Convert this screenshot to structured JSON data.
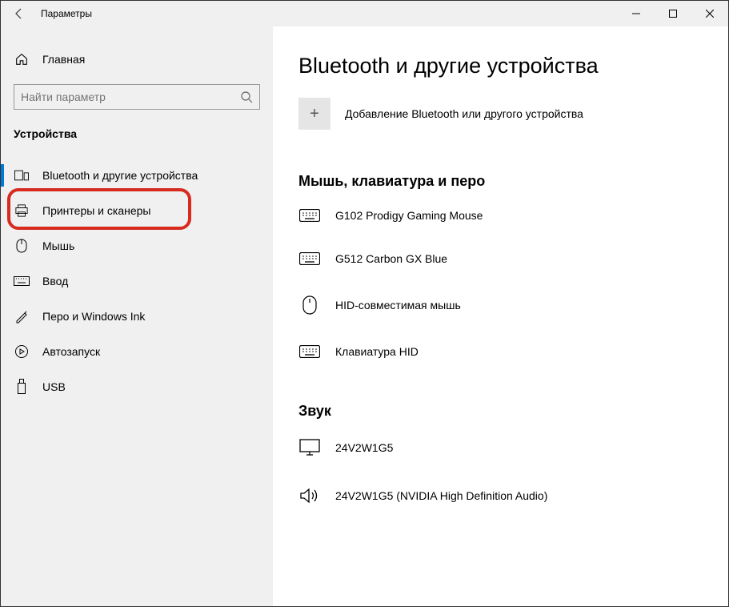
{
  "window": {
    "title": "Параметры"
  },
  "sidebar": {
    "home_label": "Главная",
    "search_placeholder": "Найти параметр",
    "category_heading": "Устройства",
    "items": [
      {
        "label": "Bluetooth и другие устройства"
      },
      {
        "label": "Принтеры и сканеры"
      },
      {
        "label": "Мышь"
      },
      {
        "label": "Ввод"
      },
      {
        "label": "Перо и Windows Ink"
      },
      {
        "label": "Автозапуск"
      },
      {
        "label": "USB"
      }
    ]
  },
  "main": {
    "page_title": "Bluetooth и другие устройства",
    "add_device_label": "Добавление Bluetooth или другого устройства",
    "sections": [
      {
        "heading": "Мышь, клавиатура и перо",
        "devices": [
          {
            "label": "G102 Prodigy Gaming Mouse",
            "icon": "keyboard"
          },
          {
            "label": "G512 Carbon GX Blue",
            "icon": "keyboard"
          },
          {
            "label": "HID-совместимая мышь",
            "icon": "mouse"
          },
          {
            "label": "Клавиатура HID",
            "icon": "keyboard"
          }
        ]
      },
      {
        "heading": "Звук",
        "devices": [
          {
            "label": "24V2W1G5",
            "icon": "monitor"
          },
          {
            "label": "24V2W1G5 (NVIDIA High Definition Audio)",
            "icon": "speaker"
          }
        ]
      }
    ]
  },
  "highlight": {
    "target_index": 1
  }
}
